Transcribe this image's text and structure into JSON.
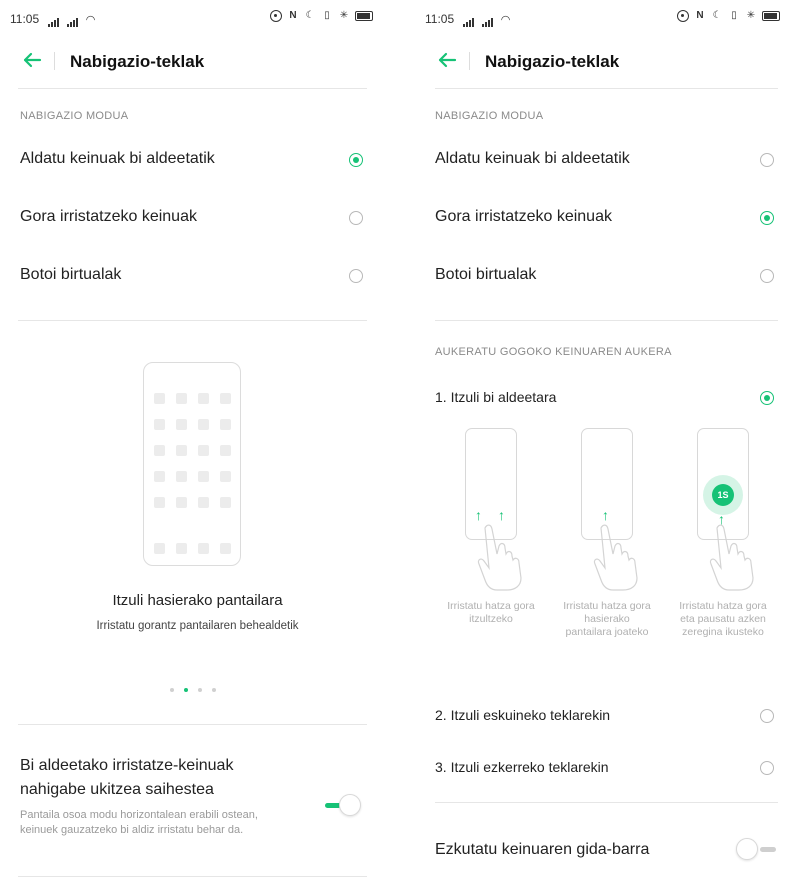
{
  "colors": {
    "accent": "#16c276",
    "text": "#222222",
    "muted": "#8a8a8a",
    "divider": "#e6e6e6"
  },
  "left": {
    "status": {
      "time": "11:05"
    },
    "header": {
      "title": "Nabigazio-teklak"
    },
    "section_title": "NABIGAZIO MODUA",
    "options": [
      {
        "label": "Aldatu keinuak bi aldeetatik",
        "selected": true
      },
      {
        "label": "Gora irristatzeko keinuak",
        "selected": false
      },
      {
        "label": "Botoi birtualak",
        "selected": false
      }
    ],
    "illustration": {
      "title": "Itzuli hasierako pantailara",
      "subtitle": "Irristatu gorantz pantailaren behealdetik",
      "pager": {
        "count": 4,
        "active": 2
      }
    },
    "switch": {
      "label_line1": "Bi aldeetako irristatze-keinuak",
      "label_line2": "nahigabe ukitzea saihestea",
      "description": "Pantaila osoa modu horizontalean erabili ostean, keinuek gauzatzeko bi aldiz irristatu behar da.",
      "on": true
    }
  },
  "right": {
    "status": {
      "time": "11:05"
    },
    "header": {
      "title": "Nabigazio-teklak"
    },
    "section_title": "NABIGAZIO MODUA",
    "options": [
      {
        "label": "Aldatu keinuak bi aldeetatik",
        "selected": false
      },
      {
        "label": "Gora irristatzeko keinuak",
        "selected": true
      },
      {
        "label": "Botoi birtualak",
        "selected": false
      }
    ],
    "gesture_section_title": "AUKERATU GOGOKO KEINUAREN AUKERA",
    "gesture_options": [
      {
        "label": "1. Itzuli bi aldeetara",
        "selected": true
      },
      {
        "label": "2. Itzuli eskuineko teklarekin",
        "selected": false
      },
      {
        "label": "3. Itzuli ezkerreko teklarekin",
        "selected": false
      }
    ],
    "captions": [
      "Irristatu hatza gora itzultzeko",
      "Irristatu hatza gora hasierako pantailara joateko",
      "Irristatu hatza gora eta pausatu azken zeregina ikusteko"
    ],
    "hold_badge": "1S",
    "switch": {
      "label": "Ezkutatu keinuaren gida-barra",
      "on": false
    }
  }
}
